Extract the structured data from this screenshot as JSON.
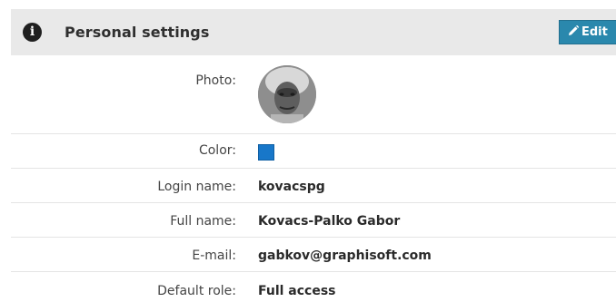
{
  "panel": {
    "icon": "info-icon",
    "icon_glyph": "i",
    "title": "Personal settings",
    "edit_label": "Edit",
    "edit_icon": "pencil-icon",
    "accent_color": "#2a88ad"
  },
  "fields": {
    "photo": {
      "label": "Photo:"
    },
    "color": {
      "label": "Color:",
      "value": "#1877c9"
    },
    "login": {
      "label": "Login name:",
      "value": "kovacspg"
    },
    "full_name": {
      "label": "Full name:",
      "value": "Kovacs-Palko Gabor"
    },
    "email": {
      "label": "E-mail:",
      "value": "gabkov@graphisoft.com"
    },
    "role": {
      "label": "Default role:",
      "value": "Full access"
    }
  }
}
